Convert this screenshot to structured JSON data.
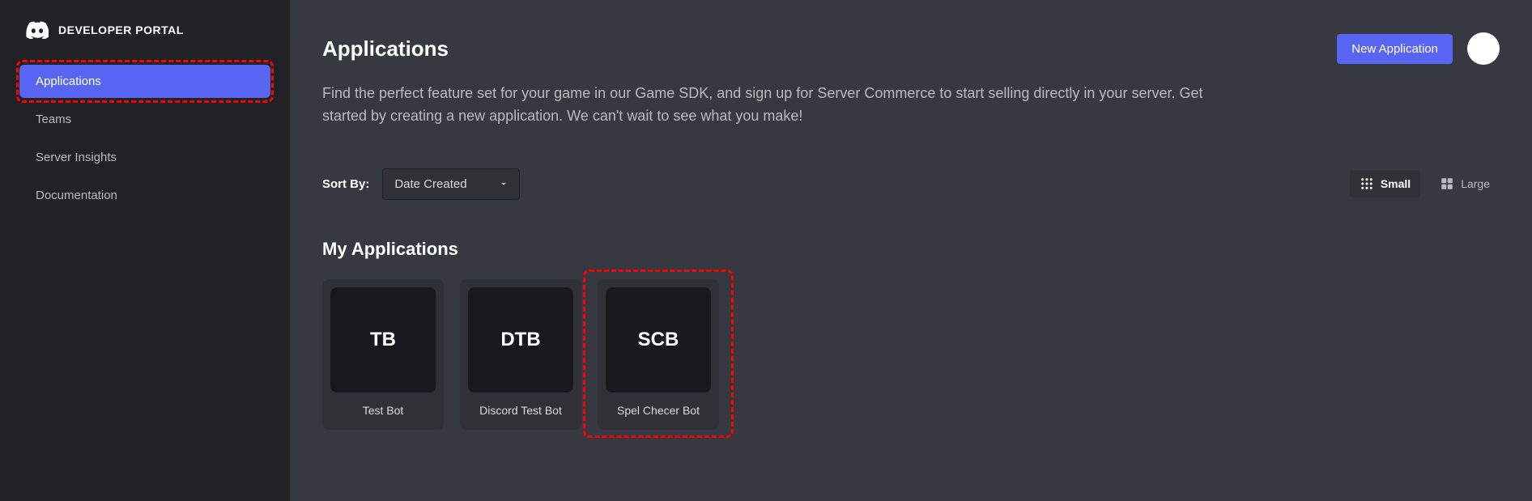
{
  "brand": "DEVELOPER PORTAL",
  "sidebar": {
    "items": [
      {
        "label": "Applications",
        "active": true,
        "highlighted": true
      },
      {
        "label": "Teams",
        "active": false,
        "highlighted": false
      },
      {
        "label": "Server Insights",
        "active": false,
        "highlighted": false
      },
      {
        "label": "Documentation",
        "active": false,
        "highlighted": false
      }
    ]
  },
  "header": {
    "title": "Applications",
    "new_button": "New Application"
  },
  "description": "Find the perfect feature set for your game in our Game SDK, and sign up for Server Commerce to start selling directly in your server. Get started by creating a new application. We can't wait to see what you make!",
  "sort": {
    "label": "Sort By:",
    "selected": "Date Created"
  },
  "view": {
    "small": "Small",
    "large": "Large"
  },
  "section_title": "My Applications",
  "apps": [
    {
      "initials": "TB",
      "name": "Test Bot",
      "highlighted": false
    },
    {
      "initials": "DTB",
      "name": "Discord Test Bot",
      "highlighted": false
    },
    {
      "initials": "SCB",
      "name": "Spel Checer Bot",
      "highlighted": true
    }
  ]
}
